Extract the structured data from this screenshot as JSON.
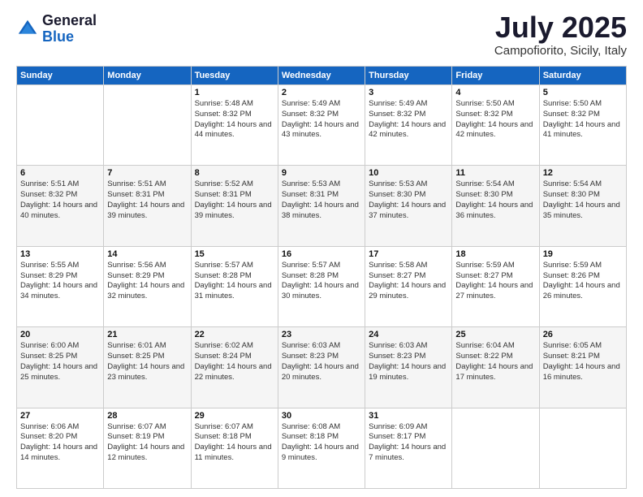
{
  "logo": {
    "general": "General",
    "blue": "Blue"
  },
  "header": {
    "month": "July 2025",
    "location": "Campofiorito, Sicily, Italy"
  },
  "days_of_week": [
    "Sunday",
    "Monday",
    "Tuesday",
    "Wednesday",
    "Thursday",
    "Friday",
    "Saturday"
  ],
  "weeks": [
    [
      {
        "day": "",
        "info": ""
      },
      {
        "day": "",
        "info": ""
      },
      {
        "day": "1",
        "info": "Sunrise: 5:48 AM\nSunset: 8:32 PM\nDaylight: 14 hours and 44 minutes."
      },
      {
        "day": "2",
        "info": "Sunrise: 5:49 AM\nSunset: 8:32 PM\nDaylight: 14 hours and 43 minutes."
      },
      {
        "day": "3",
        "info": "Sunrise: 5:49 AM\nSunset: 8:32 PM\nDaylight: 14 hours and 42 minutes."
      },
      {
        "day": "4",
        "info": "Sunrise: 5:50 AM\nSunset: 8:32 PM\nDaylight: 14 hours and 42 minutes."
      },
      {
        "day": "5",
        "info": "Sunrise: 5:50 AM\nSunset: 8:32 PM\nDaylight: 14 hours and 41 minutes."
      }
    ],
    [
      {
        "day": "6",
        "info": "Sunrise: 5:51 AM\nSunset: 8:32 PM\nDaylight: 14 hours and 40 minutes."
      },
      {
        "day": "7",
        "info": "Sunrise: 5:51 AM\nSunset: 8:31 PM\nDaylight: 14 hours and 39 minutes."
      },
      {
        "day": "8",
        "info": "Sunrise: 5:52 AM\nSunset: 8:31 PM\nDaylight: 14 hours and 39 minutes."
      },
      {
        "day": "9",
        "info": "Sunrise: 5:53 AM\nSunset: 8:31 PM\nDaylight: 14 hours and 38 minutes."
      },
      {
        "day": "10",
        "info": "Sunrise: 5:53 AM\nSunset: 8:30 PM\nDaylight: 14 hours and 37 minutes."
      },
      {
        "day": "11",
        "info": "Sunrise: 5:54 AM\nSunset: 8:30 PM\nDaylight: 14 hours and 36 minutes."
      },
      {
        "day": "12",
        "info": "Sunrise: 5:54 AM\nSunset: 8:30 PM\nDaylight: 14 hours and 35 minutes."
      }
    ],
    [
      {
        "day": "13",
        "info": "Sunrise: 5:55 AM\nSunset: 8:29 PM\nDaylight: 14 hours and 34 minutes."
      },
      {
        "day": "14",
        "info": "Sunrise: 5:56 AM\nSunset: 8:29 PM\nDaylight: 14 hours and 32 minutes."
      },
      {
        "day": "15",
        "info": "Sunrise: 5:57 AM\nSunset: 8:28 PM\nDaylight: 14 hours and 31 minutes."
      },
      {
        "day": "16",
        "info": "Sunrise: 5:57 AM\nSunset: 8:28 PM\nDaylight: 14 hours and 30 minutes."
      },
      {
        "day": "17",
        "info": "Sunrise: 5:58 AM\nSunset: 8:27 PM\nDaylight: 14 hours and 29 minutes."
      },
      {
        "day": "18",
        "info": "Sunrise: 5:59 AM\nSunset: 8:27 PM\nDaylight: 14 hours and 27 minutes."
      },
      {
        "day": "19",
        "info": "Sunrise: 5:59 AM\nSunset: 8:26 PM\nDaylight: 14 hours and 26 minutes."
      }
    ],
    [
      {
        "day": "20",
        "info": "Sunrise: 6:00 AM\nSunset: 8:25 PM\nDaylight: 14 hours and 25 minutes."
      },
      {
        "day": "21",
        "info": "Sunrise: 6:01 AM\nSunset: 8:25 PM\nDaylight: 14 hours and 23 minutes."
      },
      {
        "day": "22",
        "info": "Sunrise: 6:02 AM\nSunset: 8:24 PM\nDaylight: 14 hours and 22 minutes."
      },
      {
        "day": "23",
        "info": "Sunrise: 6:03 AM\nSunset: 8:23 PM\nDaylight: 14 hours and 20 minutes."
      },
      {
        "day": "24",
        "info": "Sunrise: 6:03 AM\nSunset: 8:23 PM\nDaylight: 14 hours and 19 minutes."
      },
      {
        "day": "25",
        "info": "Sunrise: 6:04 AM\nSunset: 8:22 PM\nDaylight: 14 hours and 17 minutes."
      },
      {
        "day": "26",
        "info": "Sunrise: 6:05 AM\nSunset: 8:21 PM\nDaylight: 14 hours and 16 minutes."
      }
    ],
    [
      {
        "day": "27",
        "info": "Sunrise: 6:06 AM\nSunset: 8:20 PM\nDaylight: 14 hours and 14 minutes."
      },
      {
        "day": "28",
        "info": "Sunrise: 6:07 AM\nSunset: 8:19 PM\nDaylight: 14 hours and 12 minutes."
      },
      {
        "day": "29",
        "info": "Sunrise: 6:07 AM\nSunset: 8:18 PM\nDaylight: 14 hours and 11 minutes."
      },
      {
        "day": "30",
        "info": "Sunrise: 6:08 AM\nSunset: 8:18 PM\nDaylight: 14 hours and 9 minutes."
      },
      {
        "day": "31",
        "info": "Sunrise: 6:09 AM\nSunset: 8:17 PM\nDaylight: 14 hours and 7 minutes."
      },
      {
        "day": "",
        "info": ""
      },
      {
        "day": "",
        "info": ""
      }
    ]
  ]
}
